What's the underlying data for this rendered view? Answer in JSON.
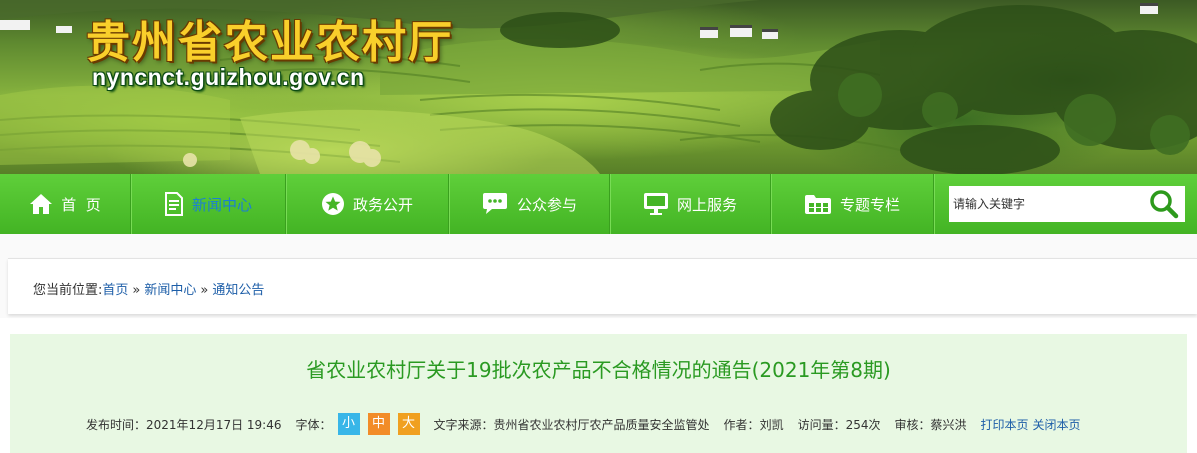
{
  "header": {
    "site_title": "贵州省农业农村厅",
    "site_url": "nyncnct.guizhou.gov.cn"
  },
  "nav": {
    "items": [
      {
        "label": "首  页",
        "icon": "home-icon"
      },
      {
        "label": "新闻中心",
        "icon": "document-icon"
      },
      {
        "label": "政务公开",
        "icon": "star-icon"
      },
      {
        "label": "公众参与",
        "icon": "chat-bubble-icon"
      },
      {
        "label": "网上服务",
        "icon": "monitor-icon"
      },
      {
        "label": "专题专栏",
        "icon": "folder-grid-icon"
      }
    ],
    "active_index": 1,
    "search_placeholder": "请输入关键字"
  },
  "breadcrumb": {
    "prefix": "您当前位置:",
    "items": [
      "首页",
      "新闻中心",
      "通知公告"
    ],
    "separator": "»"
  },
  "article": {
    "title": "省农业农村厅关于19批次农产品不合格情况的通告(2021年第8期)",
    "meta": {
      "publish_label": "发布时间：",
      "publish_time": "2021年12月17日 19:46",
      "font_label": "字体：",
      "font_sizes": [
        "小",
        "中",
        "大"
      ],
      "source_label": "文字来源：",
      "source": "贵州省农业农村厅农产品质量安全监管处",
      "author_label": "作者：",
      "author": "刘凯",
      "views_label": "访问量：",
      "views": "254次",
      "reviewer_label": "审核：",
      "reviewer": "蔡兴洪",
      "print_label": "打印本页",
      "close_label": "关闭本页"
    }
  },
  "colors": {
    "nav_green": "#4cbf2c",
    "nav_active_text": "#1b7fd2",
    "title_yellow": "#f9cf2b",
    "article_title_green": "#2a9a22",
    "article_bg": "#e8f8e3",
    "link_blue": "#1d5ea8"
  }
}
